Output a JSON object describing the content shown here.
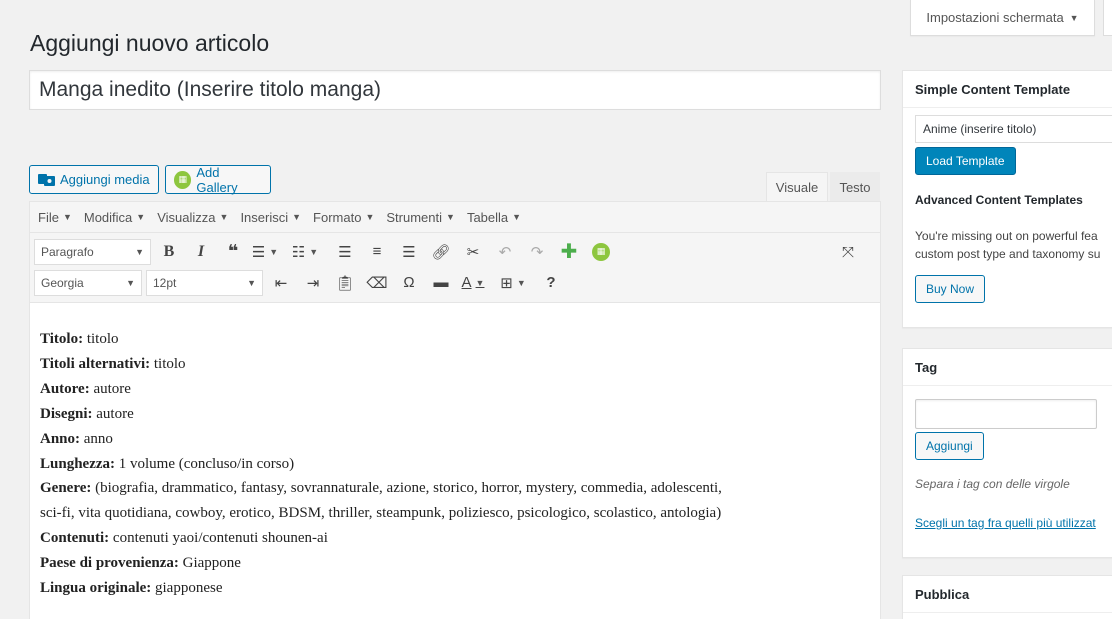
{
  "screen_options": {
    "label": "Impostazioni schermata"
  },
  "page_title": "Aggiungi nuovo articolo",
  "post_title": "Manga inedito (Inserire titolo manga)",
  "media_buttons": {
    "add_media": "Aggiungi media",
    "add_gallery": "Add Gallery"
  },
  "editor_tabs": {
    "visual": "Visuale",
    "text": "Testo"
  },
  "menubar": [
    "File",
    "Modifica",
    "Visualizza",
    "Inserisci",
    "Formato",
    "Strumenti",
    "Tabella"
  ],
  "toolbar": {
    "paragraph": "Paragrafo",
    "font": "Georgia",
    "size": "12pt"
  },
  "content": [
    {
      "label": "Titolo:",
      "value": " titolo"
    },
    {
      "label": "Titoli alternativi:",
      "value": " titolo"
    },
    {
      "label": "Autore:",
      "value": " autore"
    },
    {
      "label": "Disegni:",
      "value": " autore"
    },
    {
      "label": "Anno:",
      "value": " anno"
    },
    {
      "label": "Lunghezza:",
      "value": " 1 volume (concluso/in corso)"
    },
    {
      "label": "Genere:",
      "value": " (biografia, drammatico, fantasy, sovrannaturale, azione, storico, horror, mystery, commedia, adolescenti,"
    },
    {
      "label": "",
      "value": "sci-fi, vita quotidiana, cowboy, erotico, BDSM, thriller, steampunk, poliziesco, psicologico, scolastico, antologia)"
    },
    {
      "label": "Contenuti:",
      "value": " contenuti yaoi/contenuti shounen-ai"
    },
    {
      "label": "Paese di provenienza:",
      "value": " Giappone"
    },
    {
      "label": "Lingua originale:",
      "value": " giapponese"
    }
  ],
  "sidebar": {
    "sct": {
      "title": "Simple Content Template",
      "select_value": "Anime (inserire titolo)",
      "load_button": "Load Template",
      "act_title": "Advanced Content Templates",
      "act_text_1": "You're missing out on powerful fea",
      "act_text_2": "custom post type and taxonomy su",
      "buy_button": "Buy Now"
    },
    "tag": {
      "title": "Tag",
      "add_button": "Aggiungi",
      "howto": "Separa i tag con delle virgole",
      "link": "Scegli un tag fra quelli più utilizzat"
    },
    "publish": {
      "title": "Pubblica"
    }
  },
  "colors": {
    "accent": "#0073aa",
    "primary_button": "#0085ba",
    "gallery_green": "#8dc63f"
  }
}
